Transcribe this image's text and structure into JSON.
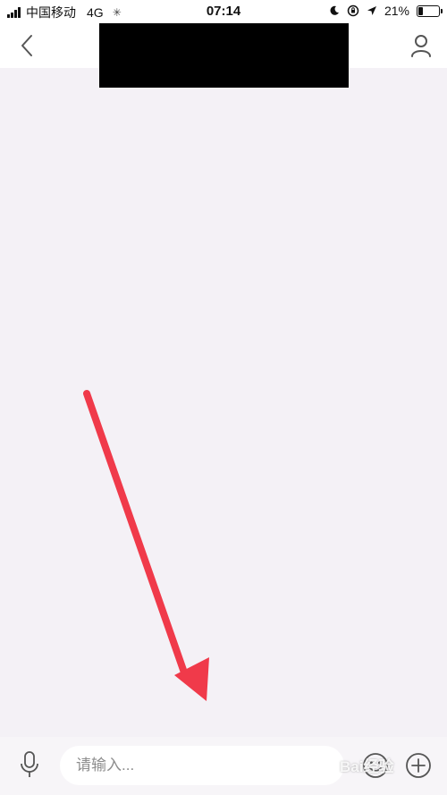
{
  "status_bar": {
    "carrier": "中国移动",
    "network": "4G",
    "time": "07:14",
    "battery_percent_label": "21%",
    "battery_level": 0.21
  },
  "nav_bar": {
    "back_icon": "chevron-left-icon",
    "profile_icon": "user-icon"
  },
  "input_bar": {
    "placeholder": "请输入...",
    "voice_icon": "microphone-icon",
    "emoji_icon": "smiley-icon",
    "plus_icon": "plus-circle-icon"
  },
  "watermark": "Bai经验",
  "colors": {
    "background": "#f4f1f6",
    "arrow": "#f03a4a",
    "bar": "#ffffff"
  }
}
